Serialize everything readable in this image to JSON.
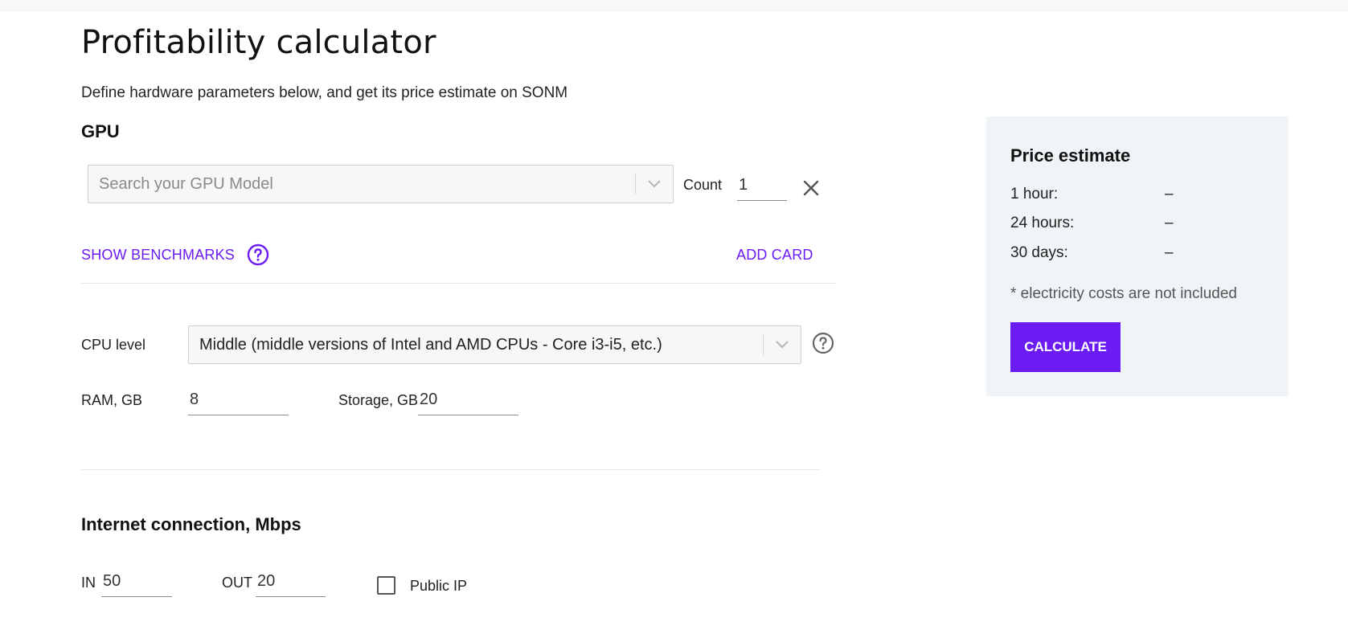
{
  "header": {
    "title": "Profitability calculator",
    "subtitle": "Define hardware parameters below, and get its price estimate on SONM"
  },
  "gpu": {
    "section_label": "GPU",
    "model_placeholder": "Search your GPU Model",
    "count_label": "Count",
    "count_value": "1",
    "show_benchmarks_label": "SHOW BENCHMARKS",
    "add_card_label": "ADD CARD"
  },
  "cpu": {
    "label": "CPU level",
    "selected": "Middle (middle versions of Intel and AMD CPUs - Core i3-i5, etc.)",
    "ram_label": "RAM, GB",
    "ram_value": "8",
    "storage_label": "Storage, GB",
    "storage_value": "20"
  },
  "internet": {
    "section_label": "Internet connection, Mbps",
    "in_label": "IN",
    "in_value": "50",
    "out_label": "OUT",
    "out_value": "20",
    "public_ip_label": "Public IP",
    "public_ip_checked": false
  },
  "price": {
    "title": "Price estimate",
    "rows": [
      {
        "label": "1 hour:",
        "value": "–"
      },
      {
        "label": "24 hours:",
        "value": "–"
      },
      {
        "label": "30 days:",
        "value": "–"
      }
    ],
    "note": "* electricity costs are not included",
    "calculate_label": "CALCULATE"
  },
  "colors": {
    "accent": "#6b1cf2",
    "panel_bg": "#eff4f7"
  },
  "icons": {
    "dropdown": "chevron-down-icon",
    "help": "help-circle-icon",
    "remove": "close-icon"
  }
}
